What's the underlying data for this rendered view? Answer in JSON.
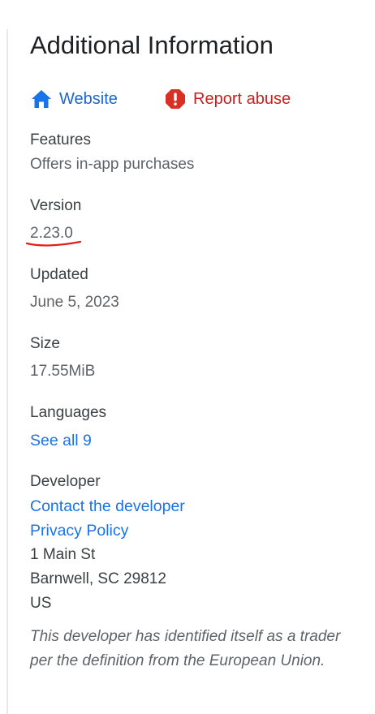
{
  "section": {
    "title": "Additional Information"
  },
  "links": {
    "website_label": "Website",
    "website_icon": "home-icon",
    "report_label": "Report abuse",
    "report_icon": "exclamation-octagon-icon"
  },
  "features": {
    "label": "Features",
    "value": "Offers in-app purchases"
  },
  "version": {
    "label": "Version",
    "value": "2.23.0"
  },
  "updated": {
    "label": "Updated",
    "value": "June 5, 2023"
  },
  "size": {
    "label": "Size",
    "value": "17.55MiB"
  },
  "languages": {
    "label": "Languages",
    "link": "See all 9"
  },
  "developer": {
    "label": "Developer",
    "contact_link": "Contact the developer",
    "privacy_link": "Privacy Policy",
    "address_line1": "1 Main St",
    "address_line2": "Barnwell, SC 29812",
    "address_line3": "US",
    "trader_note": "This developer has identified itself as a trader per the definition from the European Union."
  },
  "colors": {
    "link": "#1a73e8",
    "report": "#d93025",
    "annotation": "#e0201a"
  }
}
